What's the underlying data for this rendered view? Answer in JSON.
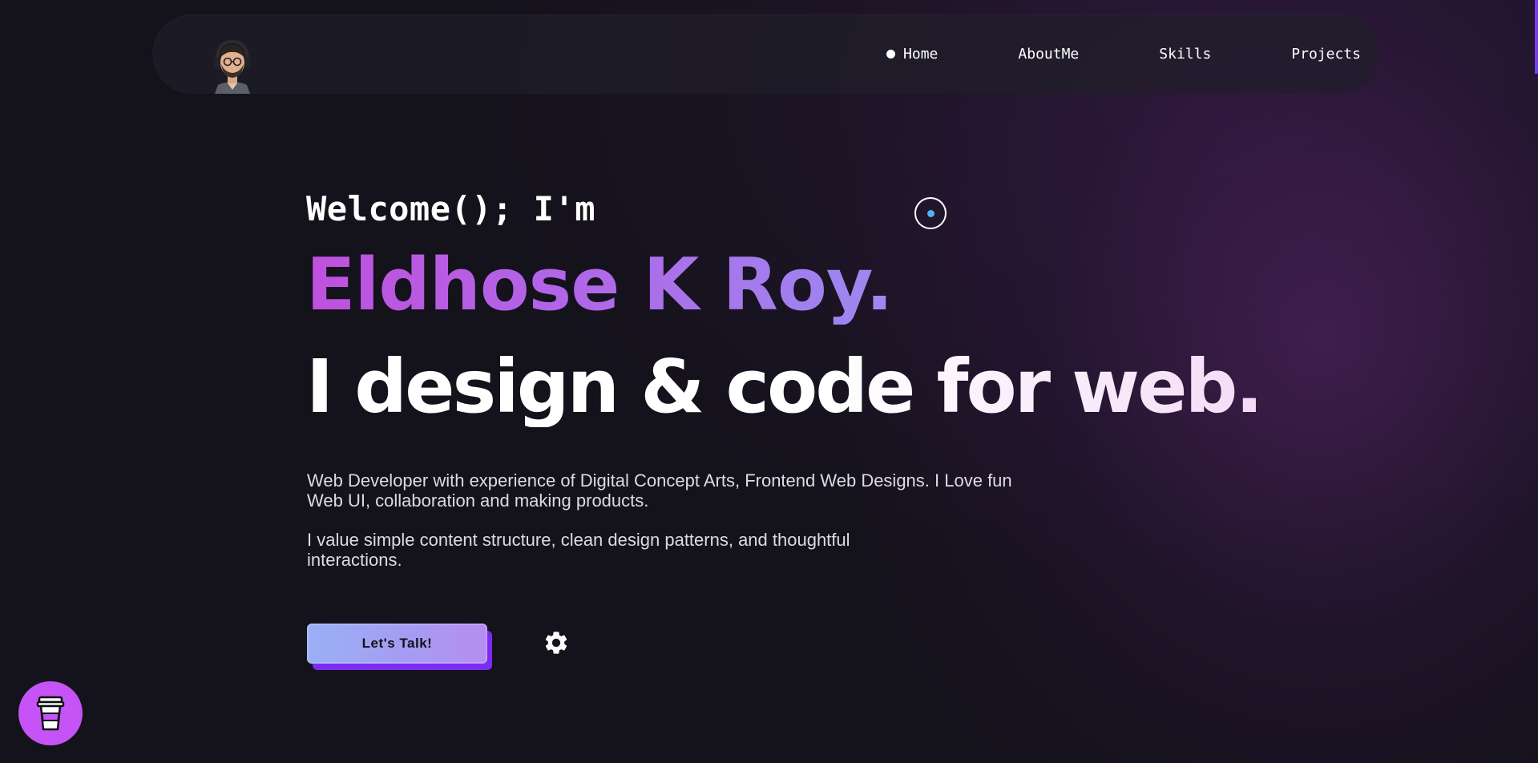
{
  "nav": {
    "items": [
      {
        "label": "Home",
        "active": true
      },
      {
        "label": "AboutMe",
        "active": false
      },
      {
        "label": "Skills",
        "active": false
      },
      {
        "label": "Projects",
        "active": false
      }
    ]
  },
  "hero": {
    "welcome": "Welcome(); I'm",
    "name": "Eldhose K Roy.",
    "tagline": "I design & code for web.",
    "paragraph1": "Web Developer with experience of Digital Concept Arts, Frontend Web Designs. I Love fun Web UI, collaboration and making products.",
    "paragraph2": "I value simple content structure, clean design patterns, and thoughtful interactions.",
    "cta_label": "Let's Talk!"
  },
  "icons": {
    "avatar": "avatar-icon",
    "settings": "gear-icon",
    "coffee": "coffee-cup-icon",
    "cursor": "cursor-ring-icon"
  },
  "colors": {
    "background": "#14121b",
    "accent_purple": "#7c2cf0",
    "name_gradient_start": "#c050de",
    "name_gradient_end": "#9b8af0",
    "coffee_button": "#c653f5",
    "cursor_dot": "#4fb3f0"
  }
}
